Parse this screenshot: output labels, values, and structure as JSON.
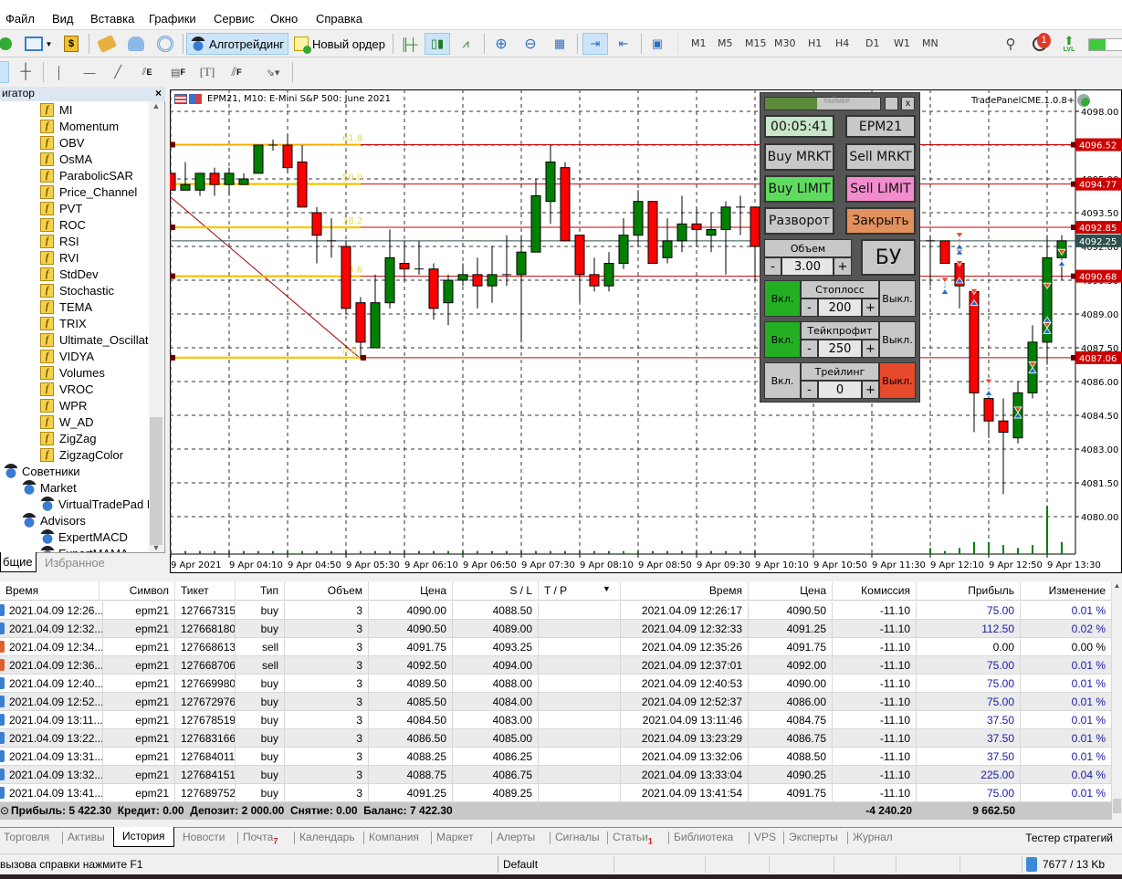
{
  "menu": [
    "Файл",
    "Вид",
    "Вставка",
    "Графики",
    "Сервис",
    "Окно",
    "Справка"
  ],
  "toolbar": {
    "algo_label": "Алготрейдинг",
    "new_order_label": "Новый ордер",
    "timeframes": [
      "M1",
      "M5",
      "M15",
      "M30",
      "H1",
      "H4",
      "D1",
      "W1",
      "MN"
    ],
    "notification_count": "1",
    "lvl_label": "LVL",
    "drawing_tools": [
      "cursor",
      "crosshair",
      "vertical-line",
      "horizontal-line",
      "trend-line",
      "fibo-expansion",
      "fibo-fan",
      "text",
      "fibo-channel",
      "arrows"
    ]
  },
  "navigator": {
    "title": "игатор",
    "indicators": [
      "MI",
      "Momentum",
      "OBV",
      "OsMA",
      "ParabolicSAR",
      "Price_Channel",
      "PVT",
      "ROC",
      "RSI",
      "RVI",
      "StdDev",
      "Stochastic",
      "TEMA",
      "TRIX",
      "Ultimate_Oscillato",
      "VIDYA",
      "Volumes",
      "VROC",
      "WPR",
      "W_AD",
      "ZigZag",
      "ZigzagColor"
    ],
    "experts_label": "Советники",
    "market_label": "Market",
    "market_items": [
      "VirtualTradePad  L"
    ],
    "advisors_label": "Advisors",
    "advisor_items": [
      "ExpertMACD",
      "ExpertMAMA"
    ],
    "tabs": [
      "бщие",
      "Избранное"
    ]
  },
  "chart": {
    "title": "EPM21, M10:  E-Mini S&P 500: June 2021",
    "indicator_label": "TradePanelCME.1.0.8+",
    "colors": {
      "bull": "#008000",
      "bear": "#ff0000",
      "fibo": "#ffd700",
      "level": "#cc0000",
      "current": "#2f4f4f"
    }
  },
  "chart_data": {
    "type": "candlestick",
    "ylim": [
      4078.5,
      4099
    ],
    "grid": true,
    "y_ticks": [
      "4098.00",
      "4096.50",
      "4095.00",
      "4093.50",
      "4092.00",
      "4090.50",
      "4089.00",
      "4087.50",
      "4086.00",
      "4084.50",
      "4083.00",
      "4081.50",
      "4080.00"
    ],
    "x_labels": [
      "9 Apr 2021",
      "9 Apr 04:10",
      "9 Apr 04:50",
      "9 Apr 05:30",
      "9 Apr 06:10",
      "9 Apr 06:50",
      "9 Apr 07:30",
      "9 Apr 08:10",
      "9 Apr 08:50",
      "9 Apr 09:30",
      "9 Apr 10:10",
      "9 Apr 10:50",
      "9 Apr 11:30",
      "9 Apr 12:10",
      "9 Apr 12:50",
      "9 Apr 13:30"
    ],
    "ohlc": [
      [
        4095.25,
        4095.25,
        4094.5,
        4094.5
      ],
      [
        4094.5,
        4095.75,
        4094.5,
        4094.75
      ],
      [
        4094.5,
        4095.25,
        4094.25,
        4095.25
      ],
      [
        4095.25,
        4095.5,
        4094.25,
        4094.75
      ],
      [
        4094.75,
        4095.5,
        4094.25,
        4095.25
      ],
      [
        4094.75,
        4095.25,
        4094.75,
        4095.0
      ],
      [
        4095.25,
        4096.5,
        4095.25,
        4096.5
      ],
      [
        4096.5,
        4096.75,
        4096.25,
        4096.5
      ],
      [
        4096.5,
        4097.0,
        4095.25,
        4095.5
      ],
      [
        4095.75,
        4096.5,
        4093.75,
        4093.75
      ],
      [
        4093.5,
        4093.75,
        4091.25,
        4092.5
      ],
      [
        4092.25,
        4093.25,
        4091.5,
        4092.25
      ],
      [
        4092.0,
        4092.25,
        4089.0,
        4089.25
      ],
      [
        4089.5,
        4089.75,
        4087.0,
        4087.75
      ],
      [
        4087.5,
        4090.75,
        4087.5,
        4089.5
      ],
      [
        4089.5,
        4092.75,
        4089.25,
        4091.5
      ],
      [
        4091.25,
        4092.25,
        4090.5,
        4091.0
      ],
      [
        4091.0,
        4092.25,
        4090.75,
        4091.0
      ],
      [
        4091.0,
        4091.25,
        4088.75,
        4089.25
      ],
      [
        4089.5,
        4090.75,
        4088.5,
        4090.5
      ],
      [
        4090.5,
        4091.25,
        4090.25,
        4090.75
      ],
      [
        4090.75,
        4091.5,
        4089.25,
        4090.25
      ],
      [
        4090.25,
        4092.0,
        4089.5,
        4090.75
      ],
      [
        4090.75,
        4092.5,
        4090.25,
        4090.75
      ],
      [
        4090.75,
        4092.5,
        4087.75,
        4091.75
      ],
      [
        4091.75,
        4095.0,
        4091.75,
        4094.25
      ],
      [
        4094.0,
        4096.5,
        4093.0,
        4095.75
      ],
      [
        4095.5,
        4095.75,
        4092.25,
        4092.25
      ],
      [
        4092.5,
        4092.5,
        4089.5,
        4090.75
      ],
      [
        4090.75,
        4091.5,
        4090.0,
        4090.25
      ],
      [
        4090.25,
        4091.75,
        4090.0,
        4091.25
      ],
      [
        4091.25,
        4093.25,
        4091.0,
        4092.5
      ],
      [
        4092.5,
        4094.5,
        4092.0,
        4094.0
      ],
      [
        4094.0,
        4094.0,
        4091.25,
        4091.25
      ],
      [
        4091.5,
        4093.25,
        4091.25,
        4092.25
      ],
      [
        4092.25,
        4094.25,
        4091.75,
        4093.0
      ],
      [
        4093.0,
        4093.75,
        4092.0,
        4092.75
      ],
      [
        4092.5,
        4093.5,
        4091.75,
        4092.75
      ],
      [
        4092.75,
        4094.0,
        4090.75,
        4093.75
      ],
      [
        4093.75,
        4094.25,
        4092.5,
        4093.75
      ],
      [
        4093.75,
        4093.75,
        4090.5,
        4092.0
      ],
      null,
      null,
      null,
      null,
      null,
      null,
      null,
      null,
      null,
      null,
      null,
      [
        4092.25,
        4092.5,
        4090.25,
        4092.25
      ],
      [
        4092.25,
        4092.25,
        4091.25,
        4091.25
      ],
      [
        4091.25,
        4091.25,
        4089.25,
        4090.25
      ],
      [
        4090.0,
        4090.0,
        4083.75,
        4085.5
      ],
      [
        4085.25,
        4085.25,
        4083.5,
        4084.25
      ],
      [
        4084.25,
        4085.25,
        4081.0,
        4083.75
      ],
      [
        4083.5,
        4086.0,
        4083.25,
        4085.5
      ],
      [
        4085.5,
        4088.5,
        4085.25,
        4087.75
      ],
      [
        4087.75,
        4092.5,
        4086.75,
        4091.5
      ],
      [
        4091.5,
        4092.5,
        4090.5,
        4092.25
      ]
    ],
    "volumes_relative": [
      1,
      1,
      1,
      1,
      1,
      1,
      1,
      1,
      1,
      1,
      1,
      1,
      1,
      1,
      1,
      1,
      1,
      1,
      1,
      1,
      1,
      1,
      1,
      1,
      1,
      1,
      1,
      1,
      1,
      1,
      1,
      1,
      1,
      1,
      1,
      1,
      1,
      1,
      1,
      1,
      1,
      1,
      1,
      1,
      1,
      1,
      1,
      1,
      1,
      1,
      1,
      1,
      2,
      1,
      2,
      4,
      4,
      3,
      2,
      3,
      16,
      4
    ],
    "fibo_levels": [
      {
        "label": "61.8",
        "price": "4096.52"
      },
      {
        "label": "50.0",
        "price": "4094.77"
      },
      {
        "label": "38.2",
        "price": "4092.85"
      },
      {
        "label": "23.6",
        "price": "4090.68"
      },
      {
        "label": "0.0",
        "price": "4087.06"
      }
    ],
    "current_price": "4092.25"
  },
  "trade_panel": {
    "title": "ТАЙМЕР",
    "timer_progress": 0.45,
    "close_x": "x",
    "timer": "00:05:41",
    "symbol": "EPM21",
    "buy_market": "Buy MRKT",
    "sell_market": "Sell MRKT",
    "buy_limit": "Buy LIMIT",
    "sell_limit": "Sell LIMIT",
    "reverse": "Разворот",
    "close": "Закрыть",
    "volume_label": "Объем",
    "volume": "3.00",
    "minus": "-",
    "plus": "+",
    "breakeven": "БУ",
    "on": "Вкл.",
    "off": "Выкл.",
    "stoploss_label": "Стоплосс",
    "stoploss": "200",
    "takeprofit_label": "Тейкпрофит",
    "takeprofit": "250",
    "trailing_label": "Трейлинг",
    "trailing": "0"
  },
  "history": {
    "columns": [
      "Время",
      "Символ",
      "Тикет",
      "Тип",
      "Объем",
      "Цена",
      "S / L",
      "T / P",
      "Время",
      "Цена",
      "Комиссия",
      "Прибыль",
      "Изменение"
    ],
    "rows": [
      [
        "2021.04.09 12:26...",
        "epm21",
        "127667315",
        "buy",
        "3",
        "4090.00",
        "4088.50",
        "",
        "2021.04.09 12:26:17",
        "4090.50",
        "-11.10",
        "75.00",
        "0.01 %"
      ],
      [
        "2021.04.09 12:32...",
        "epm21",
        "127668180",
        "buy",
        "3",
        "4090.50",
        "4089.00",
        "",
        "2021.04.09 12:32:33",
        "4091.25",
        "-11.10",
        "112.50",
        "0.02 %"
      ],
      [
        "2021.04.09 12:34...",
        "epm21",
        "127668613",
        "sell",
        "3",
        "4091.75",
        "4093.25",
        "",
        "2021.04.09 12:35:26",
        "4091.75",
        "-11.10",
        "0.00",
        "0.00 %"
      ],
      [
        "2021.04.09 12:36...",
        "epm21",
        "127668706",
        "sell",
        "3",
        "4092.50",
        "4094.00",
        "",
        "2021.04.09 12:37:01",
        "4092.00",
        "-11.10",
        "75.00",
        "0.01 %"
      ],
      [
        "2021.04.09 12:40...",
        "epm21",
        "127669980",
        "buy",
        "3",
        "4089.50",
        "4088.00",
        "",
        "2021.04.09 12:40:53",
        "4090.00",
        "-11.10",
        "75.00",
        "0.01 %"
      ],
      [
        "2021.04.09 12:52...",
        "epm21",
        "127672976",
        "buy",
        "3",
        "4085.50",
        "4084.00",
        "",
        "2021.04.09 12:52:37",
        "4086.00",
        "-11.10",
        "75.00",
        "0.01 %"
      ],
      [
        "2021.04.09 13:11...",
        "epm21",
        "127678519",
        "buy",
        "3",
        "4084.50",
        "4083.00",
        "",
        "2021.04.09 13:11:46",
        "4084.75",
        "-11.10",
        "37.50",
        "0.01 %"
      ],
      [
        "2021.04.09 13:22...",
        "epm21",
        "127683166",
        "buy",
        "3",
        "4086.50",
        "4085.00",
        "",
        "2021.04.09 13:23:29",
        "4086.75",
        "-11.10",
        "37.50",
        "0.01 %"
      ],
      [
        "2021.04.09 13:31...",
        "epm21",
        "127684011",
        "buy",
        "3",
        "4088.25",
        "4086.25",
        "",
        "2021.04.09 13:32:06",
        "4088.50",
        "-11.10",
        "37.50",
        "0.01 %"
      ],
      [
        "2021.04.09 13:32...",
        "epm21",
        "127684151",
        "buy",
        "3",
        "4088.75",
        "4086.75",
        "",
        "2021.04.09 13:33:04",
        "4090.25",
        "-11.10",
        "225.00",
        "0.04 %"
      ],
      [
        "2021.04.09 13:41...",
        "epm21",
        "127689752",
        "buy",
        "3",
        "4091.25",
        "4089.25",
        "",
        "2021.04.09 13:41:54",
        "4091.75",
        "-11.10",
        "75.00",
        "0.01 %"
      ]
    ],
    "summary": "Прибыль: 5 422.30  Кредит: 0.00  Депозит: 2 000.00  Снятие: 0.00  Баланс: 7 422.30",
    "total_commission": "-4 240.20",
    "total_profit": "9 662.50"
  },
  "bottom_tabs": [
    {
      "label": "Торговля"
    },
    {
      "label": "Активы"
    },
    {
      "label": "История",
      "active": true
    },
    {
      "label": "Новости"
    },
    {
      "label": "Почта",
      "badge": "7"
    },
    {
      "label": "Календарь"
    },
    {
      "label": "Компания"
    },
    {
      "label": "Маркет"
    },
    {
      "label": "Алерты"
    },
    {
      "label": "Сигналы"
    },
    {
      "label": "Статьи",
      "badge": "1"
    },
    {
      "label": "Библиотека"
    },
    {
      "label": "VPS"
    },
    {
      "label": "Эксперты"
    },
    {
      "label": "Журнал"
    }
  ],
  "strategy_tester": "Тестер стратегий",
  "status": {
    "help": "вызова справки нажмите F1",
    "profile": "Default",
    "traffic": "7677 / 13 Kb"
  }
}
